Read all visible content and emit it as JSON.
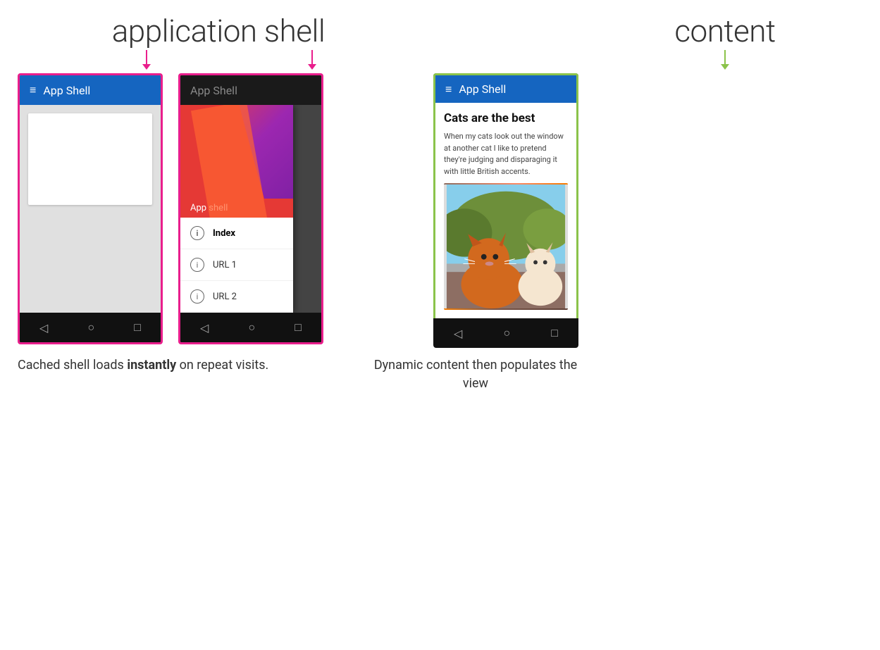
{
  "labels": {
    "app_shell_title": "application shell",
    "content_title": "content",
    "phone1_title": "App Shell",
    "phone2_title": "App Shell",
    "phone3_title": "App Shell",
    "drawer_label": "App shell",
    "drawer_index": "Index",
    "drawer_url1": "URL 1",
    "drawer_url2": "URL 2",
    "article_title": "Cats are the best",
    "article_text": "When my cats look out the window at another cat I like to pretend they're judging and disparaging it with little British accents.",
    "bottom_left_pre": "Cached shell loads ",
    "bottom_left_bold": "instantly",
    "bottom_left_post": " on repeat visits.",
    "bottom_right": "Dynamic content then populates the view",
    "nav_back": "◁",
    "nav_home": "○",
    "nav_recent": "□",
    "hamburger": "≡"
  },
  "colors": {
    "pink_border": "#d81b60",
    "green_border": "#8bc34a",
    "navbar_blue": "#1565c0",
    "text_dark": "#333333"
  }
}
